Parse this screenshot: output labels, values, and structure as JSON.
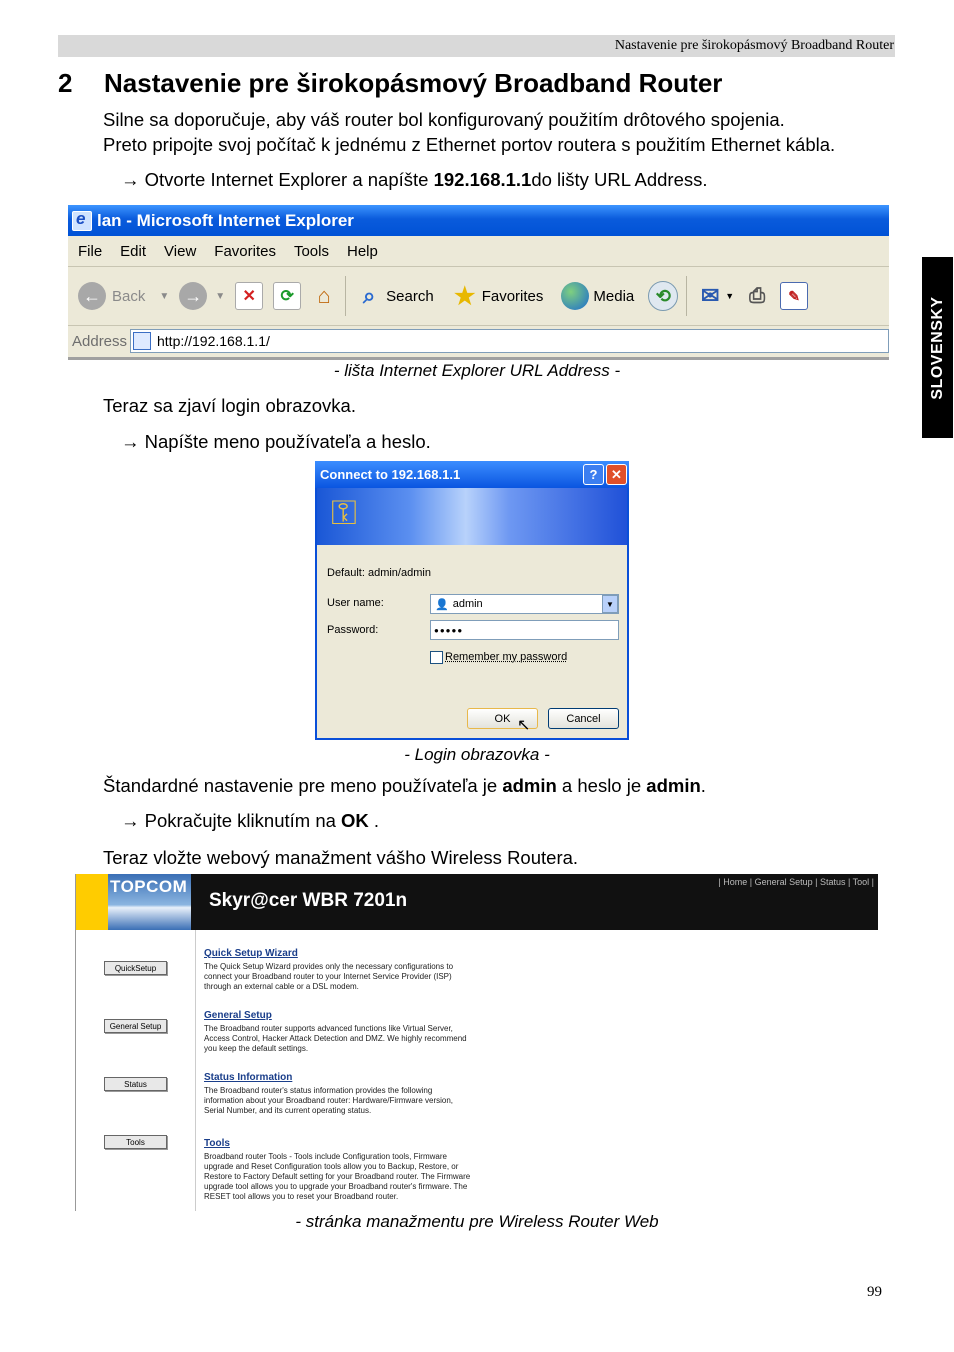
{
  "header": {
    "running_title": "Nastavenie pre širokopásmový Broadband Router"
  },
  "side_tab": "SLOVENSKY",
  "section": {
    "number": "2",
    "title": "Nastavenie pre širokopásmový Broadband Router"
  },
  "intro": {
    "line1": "Silne sa doporučuje, aby váš router bol konfigurovaný použitím drôtového spojenia.",
    "line2": "Preto pripojte svoj počítač k jednému z Ethernet portov routera s použitím Ethernet kábla."
  },
  "step1": {
    "pre": "Otvorte Internet Explorer a napíšte ",
    "bold": "192.168.1.1",
    "post": "do lišty URL Address."
  },
  "ie": {
    "title": "lan - Microsoft Internet Explorer",
    "menu": [
      "File",
      "Edit",
      "View",
      "Favorites",
      "Tools",
      "Help"
    ],
    "back": "Back",
    "search": "Search",
    "favorites": "Favorites",
    "media": "Media",
    "address_label": "Address",
    "url": "http://192.168.1.1/",
    "caption": "- lišta Internet Explorer URL Address -"
  },
  "login_text": "Teraz sa zjaví login obrazovka.",
  "step2": "Napíšte meno používateľa a heslo.",
  "dialog": {
    "title": "Connect to 192.168.1.1",
    "default": "Default: admin/admin",
    "user_label": "User name:",
    "user_value": "admin",
    "pass_label": "Password:",
    "pass_value": "●●●●●",
    "remember": "Remember my password",
    "ok": "OK",
    "cancel": "Cancel",
    "caption": "- Login obrazovka -"
  },
  "defaults": {
    "pre": "Štandardné nastavenie pre meno používateľa je ",
    "user": "admin",
    "mid": " a heslo je ",
    "pass": "admin",
    "post": "."
  },
  "step3": {
    "pre": "Pokračujte kliknutím na ",
    "bold": "OK",
    "post": " ."
  },
  "mgmt_text": "Teraz vložte webový manažment vášho Wireless Routera.",
  "web": {
    "logo": "TOPCOM",
    "model": "Skyr@cer WBR 7201n",
    "nav": "| Home | General Setup | Status | Tool |",
    "buttons": [
      "QuickSetup",
      "General Setup",
      "Status",
      "Tools"
    ],
    "sections": [
      {
        "title": "Quick Setup Wizard",
        "desc": "The Quick Setup Wizard provides only the necessary configurations to connect your Broadband router to your Internet Service Provider (ISP) through an external cable or a DSL modem."
      },
      {
        "title": "General Setup",
        "desc": "The Broadband router supports advanced functions like Virtual Server, Access Control, Hacker Attack Detection and DMZ. We highly recommend you keep the default settings."
      },
      {
        "title": "Status Information",
        "desc": "The Broadband router's status information provides the following information about your Broadband router: Hardware/Firmware version, Serial Number, and its current operating status."
      },
      {
        "title": "Tools",
        "desc": "Broadband router Tools - Tools include Configuration tools, Firmware upgrade and Reset Configuration tools allow you to Backup, Restore, or Restore to Factory Default setting for your Broadband router. The Firmware upgrade tool allows you to upgrade your Broadband router's firmware. The RESET tool allows you to reset your Broadband router."
      }
    ],
    "caption": "- stránka manažmentu pre Wireless Router Web"
  },
  "page_number": "99"
}
